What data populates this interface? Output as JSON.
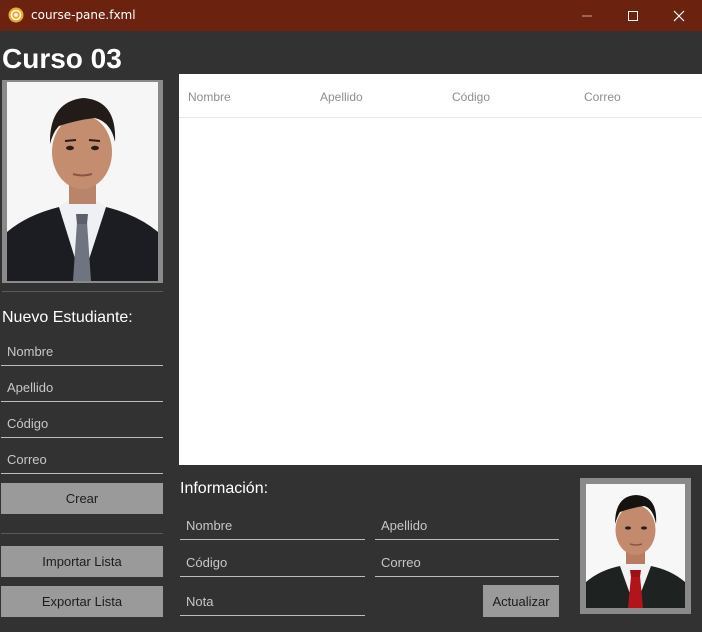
{
  "window": {
    "title": "course-pane.fxml",
    "icon": "fx-app-icon",
    "controls": [
      "minimize-icon",
      "maximize-icon",
      "close-icon"
    ]
  },
  "course": {
    "title": "Curso 03"
  },
  "new_student": {
    "heading": "Nuevo Estudiante:",
    "fields": {
      "nombre": "Nombre",
      "apellido": "Apellido",
      "codigo": "Código",
      "correo": "Correo"
    },
    "create_label": "Crear"
  },
  "list_actions": {
    "import_label": "Importar Lista",
    "export_label": "Exportar Lista"
  },
  "table": {
    "columns": [
      "Nombre",
      "Apellido",
      "Código",
      "Correo"
    ],
    "rows": []
  },
  "info": {
    "heading": "Información:",
    "fields": {
      "nombre": "Nombre",
      "apellido": "Apellido",
      "codigo": "Código",
      "correo": "Correo",
      "nota": "Nota"
    },
    "update_label": "Actualizar"
  },
  "colors": {
    "titlebar": "#6b2310",
    "background": "#323232",
    "button": "#9a9a9a"
  }
}
